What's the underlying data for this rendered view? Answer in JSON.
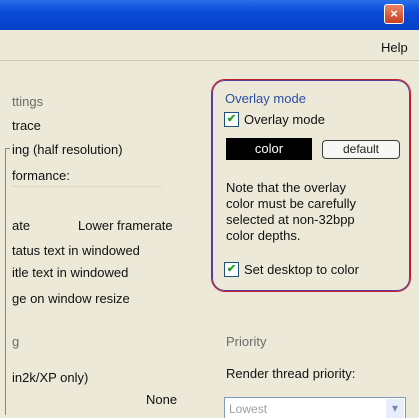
{
  "window": {
    "close_glyph": "×",
    "menu": {
      "help_label": "Help"
    }
  },
  "left_panel": {
    "settings_heading": "ttings",
    "trace_label": "trace",
    "half_res_label": "ing (half resolution)",
    "performance_label": "formance:",
    "framerate_left": "ate",
    "framerate_right": "Lower framerate",
    "status_text_label": "tatus text in windowed",
    "title_text_label": "itle text in windowed",
    "resize_label": "ge on window resize",
    "g_heading": "g",
    "win2k_label": "in2k/XP only)",
    "none_label": "None"
  },
  "overlay": {
    "heading": "Overlay mode",
    "checkbox_label": "Overlay mode",
    "checked": true,
    "color_button": "color",
    "default_button": "default",
    "note": [
      "Note that the overlay",
      "color must be carefully",
      "selected at non-32bpp",
      "color depths."
    ],
    "desktop_checkbox_label": "Set desktop to color",
    "desktop_checked": true
  },
  "priority": {
    "heading": "Priority",
    "render_label": "Render thread priority:",
    "selected": "Lowest"
  },
  "colors": {
    "titlebar": "#0a4ad6",
    "overlay_border": "#c22030",
    "check_mark": "#21a121"
  }
}
